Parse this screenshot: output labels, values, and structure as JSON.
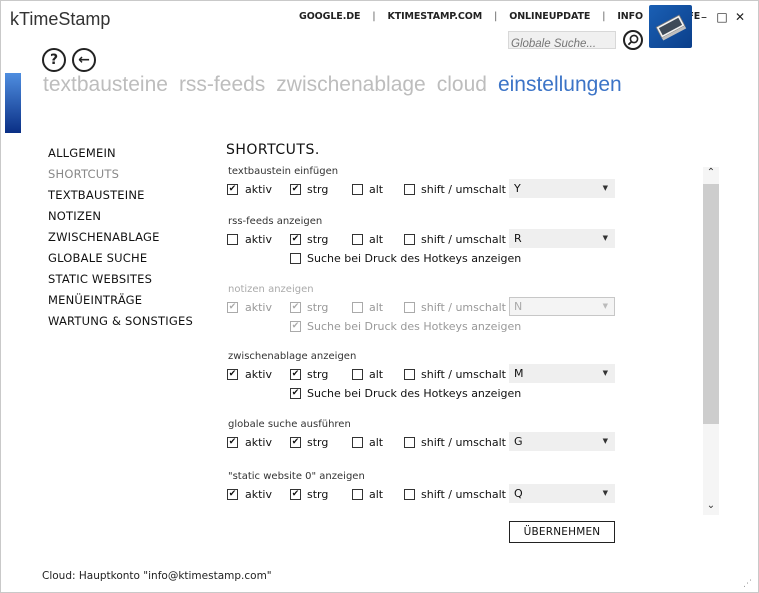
{
  "app": {
    "title": "kTimeStamp"
  },
  "topnav": [
    "GOOGLE.DE",
    "KTIMESTAMP.COM",
    "ONLINEUPDATE",
    "INFO",
    "HILFE"
  ],
  "search": {
    "placeholder": "Globale Suche..."
  },
  "window_controls": {
    "minimize": "–",
    "maximize": "□",
    "close": "✕"
  },
  "nav": {
    "help": "?",
    "back": "←"
  },
  "tabs": [
    {
      "label": "textbausteine",
      "active": false
    },
    {
      "label": "rss-feeds",
      "active": false
    },
    {
      "label": "zwischenablage",
      "active": false
    },
    {
      "label": "cloud",
      "active": false
    },
    {
      "label": "einstellungen",
      "active": true
    }
  ],
  "leftnav": [
    {
      "label": "ALLGEMEIN",
      "active": false
    },
    {
      "label": "SHORTCUTS",
      "active": true
    },
    {
      "label": "TEXTBAUSTEINE",
      "active": false
    },
    {
      "label": "NOTIZEN",
      "active": false
    },
    {
      "label": "ZWISCHENABLAGE",
      "active": false
    },
    {
      "label": "GLOBALE SUCHE",
      "active": false
    },
    {
      "label": "STATIC WEBSITES",
      "active": false
    },
    {
      "label": "MENÜEINTRÄGE",
      "active": false
    },
    {
      "label": "WARTUNG & SONSTIGES",
      "active": false
    }
  ],
  "heading": "SHORTCUTS.",
  "labels": {
    "aktiv": "aktiv",
    "strg": "strg",
    "alt": "alt",
    "shift": "shift / umschalt",
    "suche": "Suche bei Druck des Hotkeys anzeigen"
  },
  "groups": [
    {
      "title": "textbaustein einfügen",
      "disabled": false,
      "aktiv": true,
      "strg": true,
      "alt": false,
      "shift": false,
      "key": "Y",
      "suche": null
    },
    {
      "title": "rss-feeds anzeigen",
      "disabled": false,
      "aktiv": false,
      "strg": true,
      "alt": false,
      "shift": false,
      "key": "R",
      "suche": false
    },
    {
      "title": "notizen anzeigen",
      "disabled": true,
      "aktiv": true,
      "strg": true,
      "alt": false,
      "shift": false,
      "key": "N",
      "suche": true
    },
    {
      "title": "zwischenablage anzeigen",
      "disabled": false,
      "aktiv": true,
      "strg": true,
      "alt": false,
      "shift": false,
      "key": "M",
      "suche": true
    },
    {
      "title": "globale suche ausführen",
      "disabled": false,
      "aktiv": true,
      "strg": true,
      "alt": false,
      "shift": false,
      "key": "G",
      "suche": null
    },
    {
      "title": "\"static website 0\" anzeigen",
      "disabled": false,
      "aktiv": true,
      "strg": true,
      "alt": false,
      "shift": false,
      "key": "Q",
      "suche": null
    }
  ],
  "apply_label": "ÜBERNEHMEN",
  "status": "Cloud: Hauptkonto \"info@ktimestamp.com\""
}
